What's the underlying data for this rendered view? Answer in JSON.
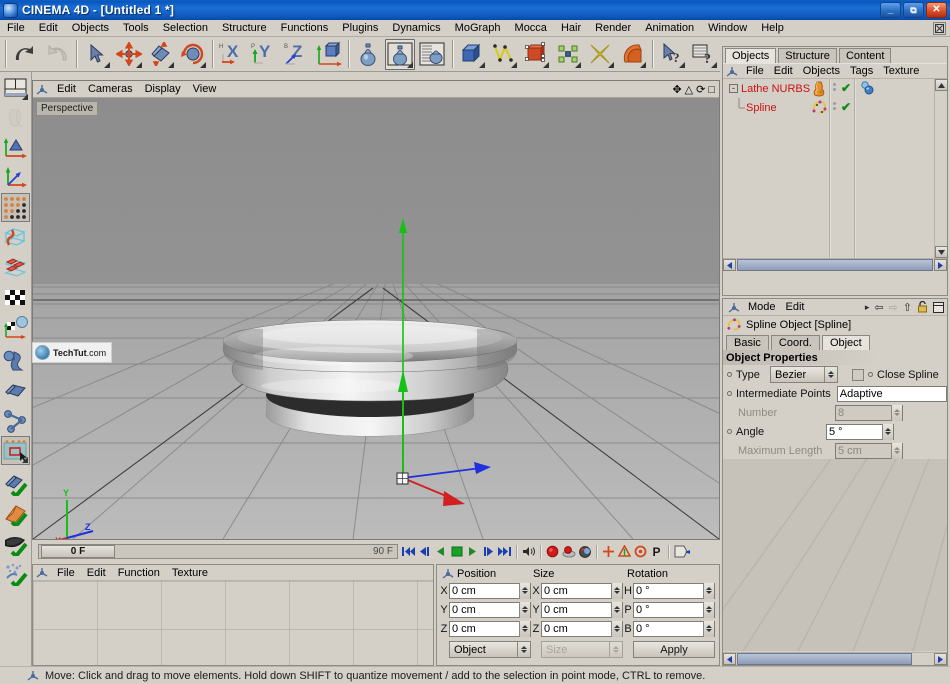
{
  "window": {
    "title": "CINEMA 4D - [Untitled 1 *]",
    "minimize_label": "_",
    "restore_label": "❐",
    "close_label": "✕"
  },
  "menubar": {
    "items": [
      "File",
      "Edit",
      "Objects",
      "Tools",
      "Selection",
      "Structure",
      "Functions",
      "Plugins",
      "Dynamics",
      "MoGraph",
      "Mocca",
      "Hair",
      "Render",
      "Animation",
      "Window",
      "Help"
    ],
    "mdi_close": "✕"
  },
  "toolbar_top": {
    "buttons": [
      {
        "name": "undo-icon",
        "label": "Undo"
      },
      {
        "name": "redo-icon",
        "label": "Redo"
      },
      {
        "name": "select-tool-icon",
        "label": "Live Selection"
      },
      {
        "name": "move-tool-icon",
        "label": "Move"
      },
      {
        "name": "scale-tool-icon",
        "label": "Scale"
      },
      {
        "name": "rotate-tool-icon",
        "label": "Rotate"
      },
      {
        "name": "x-axis-lock-icon",
        "label": "X"
      },
      {
        "name": "y-axis-lock-icon",
        "label": "Y"
      },
      {
        "name": "z-axis-lock-icon",
        "label": "Z"
      },
      {
        "name": "world-object-coord-icon",
        "label": "World/Object"
      },
      {
        "name": "render-view-icon",
        "label": "Render View"
      },
      {
        "name": "render-picture-viewer-icon",
        "label": "Render to Picture Viewer"
      },
      {
        "name": "render-settings-icon",
        "label": "Render Settings"
      },
      {
        "name": "primitive-cube-icon",
        "label": "Cube"
      },
      {
        "name": "spline-pen-icon",
        "label": "Spline"
      },
      {
        "name": "nurbs-icon",
        "label": "NURBS"
      },
      {
        "name": "modeling-object-icon",
        "label": "Modeling"
      },
      {
        "name": "deformer-icon",
        "label": "Deformer"
      },
      {
        "name": "scene-object-icon",
        "label": "Scene"
      },
      {
        "name": "help-cursor-icon",
        "label": "Context Help"
      },
      {
        "name": "help-doc-icon",
        "label": "Help"
      }
    ]
  },
  "toolbar_left": {
    "buttons": [
      {
        "name": "layout-icon",
        "label": "Layout"
      },
      {
        "name": "make-editable-icon",
        "label": "Make Editable"
      },
      {
        "name": "model-mode-icon",
        "label": "Model Mode"
      },
      {
        "name": "object-axis-mode-icon",
        "label": "Object Axis"
      },
      {
        "name": "points-mode-icon",
        "label": "Points"
      },
      {
        "name": "edges-mode-icon",
        "label": "Edges"
      },
      {
        "name": "polygons-mode-icon",
        "label": "Polygons"
      },
      {
        "name": "texture-mode-icon",
        "label": "Texture"
      },
      {
        "name": "texture-axis-mode-icon",
        "label": "Texture Axis"
      },
      {
        "name": "object-tool-icon",
        "label": "Object Tool"
      },
      {
        "name": "workplane-icon",
        "label": "Workplane"
      },
      {
        "name": "ik-chain-icon",
        "label": "IK"
      },
      {
        "name": "viewport-solo-icon",
        "label": "Viewport Solo"
      },
      {
        "name": "enable-axis-icon",
        "label": "Enable Axis Modification"
      },
      {
        "name": "enable-snap-icon",
        "label": "Enable Snapping"
      },
      {
        "name": "enable-quantize-icon",
        "label": "Quantize"
      },
      {
        "name": "enable-particles-icon",
        "label": "Particle Modifier"
      }
    ]
  },
  "viewport": {
    "menu": [
      "Edit",
      "Cameras",
      "Display",
      "View"
    ],
    "label": "Perspective",
    "nav_icons": [
      {
        "name": "viewport-move-icon",
        "glyph": "✥"
      },
      {
        "name": "viewport-zoom-icon",
        "glyph": "△"
      },
      {
        "name": "viewport-rotate-icon",
        "glyph": "⟳"
      },
      {
        "name": "viewport-maximize-icon",
        "glyph": "□"
      }
    ],
    "watermark": {
      "bold": "TechTut",
      "rest": ".com"
    },
    "world_axis": {
      "y": "Y",
      "x": "X",
      "z": "Z"
    },
    "axis_colors": {
      "x": "#d22020",
      "y": "#15c115",
      "z": "#2030dd"
    },
    "object_name": "Lathe NURBS object"
  },
  "timeline": {
    "current_frame": "0 F",
    "end_frame": "90 F",
    "controls": [
      {
        "name": "goto-start-button",
        "glyph": "⏮"
      },
      {
        "name": "prev-key-button",
        "glyph": "◀|"
      },
      {
        "name": "play-backwards-button",
        "glyph": "◀"
      },
      {
        "name": "stop-button",
        "glyph": "■"
      },
      {
        "name": "play-forward-button",
        "glyph": "▶"
      },
      {
        "name": "next-key-button",
        "glyph": "|▶"
      },
      {
        "name": "goto-end-button",
        "glyph": "⏭"
      },
      {
        "name": "sound-button",
        "glyph": "⏵"
      },
      {
        "name": "record-button",
        "glyph": "●"
      },
      {
        "name": "autokeying-button",
        "glyph": "●"
      },
      {
        "name": "keyframe-selection-button",
        "glyph": "○"
      },
      {
        "name": "key-position-button",
        "glyph": "+"
      },
      {
        "name": "key-scale-button",
        "glyph": "△"
      },
      {
        "name": "key-rotation-button",
        "glyph": "◎"
      },
      {
        "name": "key-parameter-button",
        "glyph": "P"
      },
      {
        "name": "pla-button",
        "glyph": "▶"
      }
    ]
  },
  "material_manager": {
    "menu": [
      "File",
      "Edit",
      "Function",
      "Texture"
    ],
    "materials": []
  },
  "coordinates": {
    "headers": {
      "position": "Position",
      "size": "Size",
      "rotation": "Rotation"
    },
    "rows": [
      {
        "pos_axis": "X",
        "pos_value": "0 cm",
        "size_axis": "X",
        "size_value": "0 cm",
        "rot_axis": "H",
        "rot_value": "0 °"
      },
      {
        "pos_axis": "Y",
        "pos_value": "0 cm",
        "size_axis": "Y",
        "size_value": "0 cm",
        "rot_axis": "P",
        "rot_value": "0 °"
      },
      {
        "pos_axis": "Z",
        "pos_value": "0 cm",
        "size_axis": "Z",
        "size_value": "0 cm",
        "rot_axis": "B",
        "rot_value": "0 °"
      }
    ],
    "object_mode": "Object",
    "size_mode": "Size",
    "apply_label": "Apply"
  },
  "object_manager": {
    "tabs": [
      {
        "label": "Objects",
        "active": true
      },
      {
        "label": "Structure",
        "active": false
      },
      {
        "label": "Content",
        "active": false
      }
    ],
    "menu": [
      "File",
      "Edit",
      "Objects",
      "Tags",
      "Texture"
    ],
    "tree": [
      {
        "name": "Lathe NURBS",
        "expander": "-",
        "depth": 0,
        "icon": "lathe-nurbs-icon",
        "visible_check": "✔",
        "tag": "phong-tag-icon"
      },
      {
        "name": "Spline",
        "expander": "",
        "depth": 1,
        "icon": "spline-icon",
        "visible_check": "✔",
        "tag": ""
      }
    ]
  },
  "attribute_manager": {
    "menu": [
      "Mode",
      "Edit"
    ],
    "nav_icons": [
      {
        "name": "attr-forward-icon",
        "glyph": "▸"
      },
      {
        "name": "attr-back-icon",
        "glyph": "⇦"
      },
      {
        "name": "attr-next-icon",
        "glyph": "⇨"
      },
      {
        "name": "attr-up-icon",
        "glyph": "⇧"
      },
      {
        "name": "attr-lock-icon",
        "glyph": "ὑ2"
      },
      {
        "name": "attr-panel-icon",
        "glyph": "▤"
      }
    ],
    "object_title": "Spline Object [Spline]",
    "tabs": [
      {
        "label": "Basic",
        "active": false
      },
      {
        "label": "Coord.",
        "active": false
      },
      {
        "label": "Object",
        "active": true
      }
    ],
    "section_title": "Object Properties",
    "fields": [
      {
        "label": "Type",
        "value": "Bezier",
        "kind": "combo",
        "enabled": true
      },
      {
        "label": "Close Spline",
        "value": "",
        "kind": "checkbox",
        "enabled": true,
        "checked": false
      },
      {
        "label": "Intermediate Points",
        "value": "Adaptive",
        "kind": "combo-wide",
        "enabled": true
      },
      {
        "label": "Number",
        "value": "8",
        "kind": "number",
        "enabled": false
      },
      {
        "label": "Angle",
        "value": "5 °",
        "kind": "number",
        "enabled": true
      },
      {
        "label": "Maximum Length",
        "value": "5 cm",
        "kind": "number",
        "enabled": false
      }
    ]
  },
  "statusbar": {
    "icon": "move-tool-icon",
    "text": "Move: Click and drag to move elements. Hold down SHIFT to quantize movement / add to the selection in point mode, CTRL to remove."
  },
  "colors": {
    "title_blue": "#0a57bd",
    "chrome": "#d4d0c8",
    "object_red": "#cc1111",
    "check_green": "#0a8c12",
    "axis_x": "#d22020",
    "axis_y": "#15c115",
    "axis_z": "#2030dd"
  }
}
